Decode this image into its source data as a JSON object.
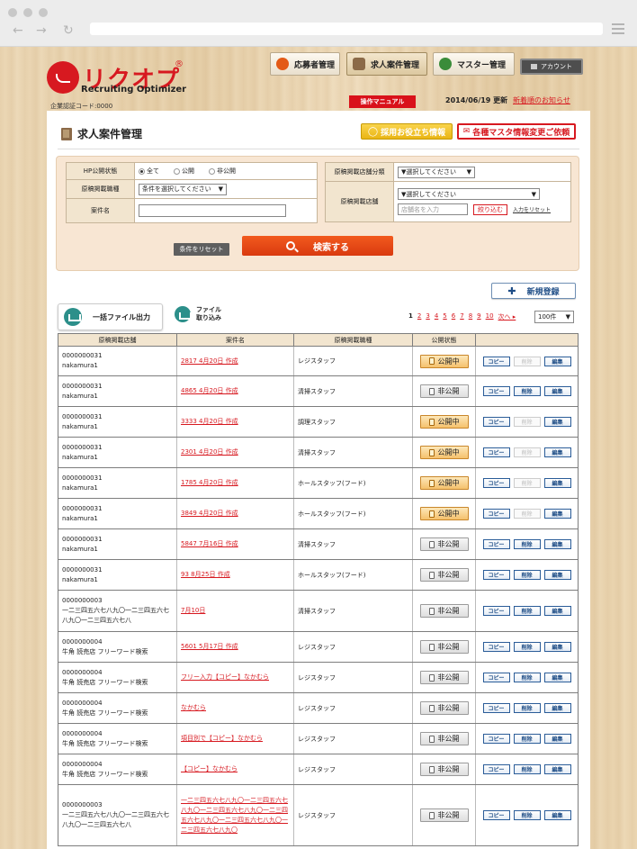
{
  "header": {
    "logo_text": "リクオプ",
    "logo_sub": "Recruiting Optimizer",
    "logo_reg": "®",
    "company_code": "企業認証コード:0000",
    "nav": [
      {
        "label": "応募者管理",
        "icon": "person-icon",
        "color": "#e35a17"
      },
      {
        "label": "求人案件管理",
        "icon": "book-icon",
        "color": "#8b6a48"
      },
      {
        "label": "マスター管理",
        "icon": "gear-icon",
        "color": "#3a8c3a"
      }
    ],
    "account_label": "アカウント",
    "manual_label": "操作マニュアル",
    "update_date": "2014/06/19 更新",
    "news_link": "新着順のお知らせ"
  },
  "page": {
    "title": "求人案件管理",
    "tips_button": "採用お役立ち情報",
    "master_change_button": "各種マスタ情報変更ご依頼"
  },
  "search": {
    "hp_status_label": "HP公開状態",
    "hp_status_options": [
      "全て",
      "公開",
      "非公開"
    ],
    "job_type_label": "原稿掲載職種",
    "job_type_value": "条件を選択してください",
    "case_name_label": "案件名",
    "case_name_value": "",
    "store_category_label": "原稿掲載店舗分類",
    "store_category_value": "▼選択してください",
    "store_label": "原稿掲載店舗",
    "store_value": "▼選択してください",
    "store_placeholder": "店舗名を入力",
    "narrow_button": "絞り込む",
    "input_reset_link": "入力をリセット",
    "reset_button": "条件をリセット",
    "search_button": "検索する"
  },
  "toolbar": {
    "new_button": "新規登録",
    "export_button": "一括ファイル出力",
    "import_button_line1": "ファイル",
    "import_button_line2": "取り込み",
    "pages": [
      "1",
      "2",
      "3",
      "4",
      "5",
      "6",
      "7",
      "8",
      "9",
      "10"
    ],
    "next_label": "次へ ▸",
    "per_page": "100件"
  },
  "table": {
    "columns": [
      "原稿掲載店舗",
      "案件名",
      "原稿掲載職種",
      "公開状態",
      ""
    ],
    "actions": {
      "copy": "コピー",
      "delete": "削除",
      "edit": "編集"
    },
    "rows": [
      {
        "store_code": "0000000031",
        "store_name": "nakamura1",
        "case": "2817 4月20日 作成",
        "job": "レジスタッフ",
        "status": "公開中",
        "published": true
      },
      {
        "store_code": "0000000031",
        "store_name": "nakamura1",
        "case": "4865 4月20日 作成",
        "job": "清掃スタッフ",
        "status": "非公開",
        "published": false
      },
      {
        "store_code": "0000000031",
        "store_name": "nakamura1",
        "case": "3333 4月20日 作成",
        "job": "調理スタッフ",
        "status": "公開中",
        "published": true
      },
      {
        "store_code": "0000000031",
        "store_name": "nakamura1",
        "case": "2301 4月20日 作成",
        "job": "清掃スタッフ",
        "status": "公開中",
        "published": true
      },
      {
        "store_code": "0000000031",
        "store_name": "nakamura1",
        "case": "1785 4月20日 作成",
        "job": "ホールスタッフ(フード)",
        "status": "公開中",
        "published": true
      },
      {
        "store_code": "0000000031",
        "store_name": "nakamura1",
        "case": "3849 4月20日 作成",
        "job": "ホールスタッフ(フード)",
        "status": "公開中",
        "published": true
      },
      {
        "store_code": "0000000031",
        "store_name": "nakamura1",
        "case": "5847 7月16日 作成",
        "job": "清掃スタッフ",
        "status": "非公開",
        "published": false
      },
      {
        "store_code": "0000000031",
        "store_name": "nakamura1",
        "case": "93 8月25日 作成",
        "job": "ホールスタッフ(フード)",
        "status": "非公開",
        "published": false
      },
      {
        "store_code": "0000000003",
        "store_name": "一二三四五六七八九〇一二三四五六七八九〇一二三四五六七八",
        "case": "7月10日",
        "job": "清掃スタッフ",
        "status": "非公開",
        "published": false
      },
      {
        "store_code": "0000000004",
        "store_name": "牛角 読売店 フリーワード検索",
        "case": "5601 5月17日 作成",
        "job": "レジスタッフ",
        "status": "非公開",
        "published": false
      },
      {
        "store_code": "0000000004",
        "store_name": "牛角 読売店 フリーワード検索",
        "case": "フリー入力【コピー】なかむら",
        "job": "レジスタッフ",
        "status": "非公開",
        "published": false
      },
      {
        "store_code": "0000000004",
        "store_name": "牛角 読売店 フリーワード検索",
        "case": "なかむら",
        "job": "レジスタッフ",
        "status": "非公開",
        "published": false
      },
      {
        "store_code": "0000000004",
        "store_name": "牛角 読売店 フリーワード検索",
        "case": "項目別で【コピー】なかむら",
        "job": "レジスタッフ",
        "status": "非公開",
        "published": false
      },
      {
        "store_code": "0000000004",
        "store_name": "牛角 読売店 フリーワード検索",
        "case": "【コピー】なかむら",
        "job": "レジスタッフ",
        "status": "非公開",
        "published": false
      },
      {
        "store_code": "0000000003",
        "store_name": "一二三四五六七八九〇一二三四五六七八九〇一二三四五六七八",
        "case": "一二三四五六七八九〇一二三四五六七八九〇一二三四五六七八九〇一二三四五六七八九〇一二三四五六七八九〇一二三四五六七八九〇",
        "job": "レジスタッフ",
        "status": "非公開",
        "published": false
      }
    ]
  },
  "colors": {
    "brand_red": "#d71920",
    "search_orange": "#e84a14",
    "panel_bg": "#ffffff",
    "header_cell_bg": "#f2e5cf"
  }
}
